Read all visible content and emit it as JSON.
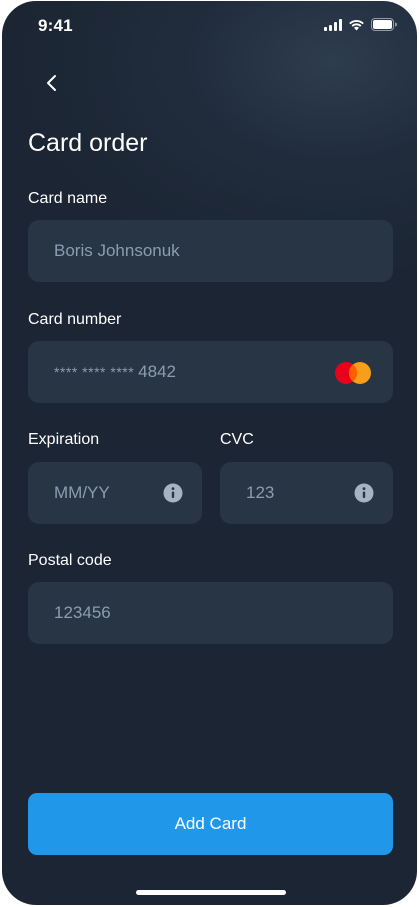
{
  "status_bar": {
    "time": "9:41",
    "icons": [
      "cellular-signal-icon",
      "wifi-icon",
      "battery-icon"
    ]
  },
  "header": {
    "back_icon": "chevron-left-icon",
    "title": "Card order"
  },
  "form": {
    "card_name": {
      "label": "Card name",
      "value": "Boris Johnsonuk"
    },
    "card_number": {
      "label": "Card number",
      "masked_prefix": "**** **** ****",
      "last_digits": "4842",
      "brand_icon": "mastercard-icon"
    },
    "expiration": {
      "label": "Expiration",
      "placeholder": "MM/YY",
      "icon": "info-icon"
    },
    "cvc": {
      "label": "CVC",
      "placeholder": "123",
      "icon": "info-icon"
    },
    "postal_code": {
      "label": "Postal code",
      "placeholder": "123456"
    }
  },
  "actions": {
    "add_card_label": "Add Card"
  },
  "colors": {
    "background": "#1b2533",
    "field": "#283545",
    "field_text": "#8c9cb0",
    "accent": "#2197ea",
    "mastercard_red": "#eb001b",
    "mastercard_orange": "#f79e1b"
  }
}
